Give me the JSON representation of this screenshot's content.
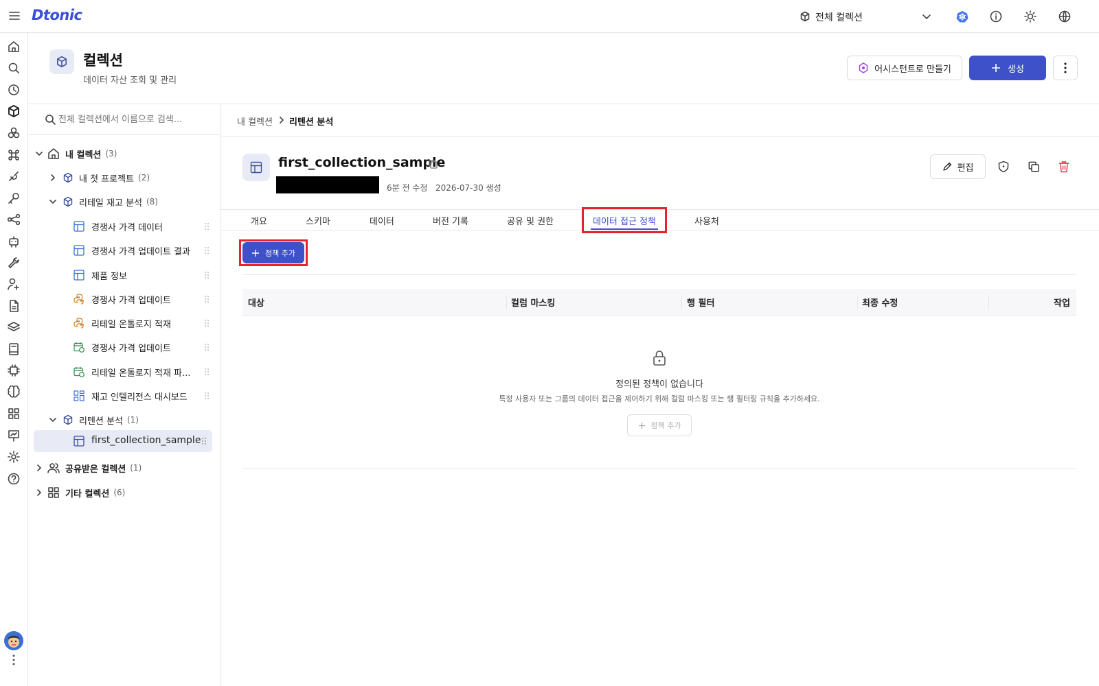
{
  "app": {
    "logo": "Dtonic"
  },
  "topbar": {
    "collection_select": "전체 컬렉션"
  },
  "page": {
    "title": "컬렉션",
    "subtitle": "데이터 자산 조회 및 관리",
    "assistant_button": "어시스턴트로 만들기",
    "create_button": "생성"
  },
  "search": {
    "placeholder": "전체 컬렉션에서 이름으로 검색..."
  },
  "tree": {
    "my_collections": {
      "label": "내 컬렉션",
      "count": "(3)"
    },
    "projects": [
      {
        "label": "내 첫 프로젝트",
        "count": "(2)"
      },
      {
        "label": "리테일 재고 분석",
        "count": "(8)"
      }
    ],
    "retail_items": [
      {
        "label": "경쟁사 가격 데이터",
        "icon": "table-icon"
      },
      {
        "label": "경쟁사 가격 업데이트 결과",
        "icon": "table-icon"
      },
      {
        "label": "제품 정보",
        "icon": "table-icon"
      },
      {
        "label": "경쟁사 가격 업데이트",
        "icon": "python-icon"
      },
      {
        "label": "리테일 온톨로지 적재",
        "icon": "python-icon"
      },
      {
        "label": "경쟁사 가격 업데이트",
        "icon": "schedule-icon"
      },
      {
        "label": "리테일 온톨로지 적재 파...",
        "icon": "schedule-icon"
      },
      {
        "label": "재고 인텔리전스 대시보드",
        "icon": "dashboard-icon"
      }
    ],
    "retention": {
      "label": "리텐션 분석",
      "count": "(1)"
    },
    "selected_item": "first_collection_sample",
    "shared": {
      "label": "공유받은 컬렉션",
      "count": "(1)"
    },
    "other": {
      "label": "기타 컬렉션",
      "count": "(6)"
    }
  },
  "breadcrumb": {
    "parent": "내 컬렉션",
    "current": "리텐션 분석"
  },
  "dataset": {
    "name": "first_collection_sample",
    "modified": "6분 전 수정",
    "created": "2026-07-30 생성",
    "edit_button": "편집"
  },
  "tabs": [
    "개요",
    "스키마",
    "데이터",
    "버전 기록",
    "공유 및 권한",
    "데이터 접근 정책",
    "사용처"
  ],
  "active_tab": "데이터 접근 정책",
  "policy": {
    "add_button": "정책 추가",
    "columns": [
      "대상",
      "컬럼 마스킹",
      "행 필터",
      "최종 수정",
      "작업"
    ],
    "empty_title": "정의된 정책이 없습니다",
    "empty_desc": "특정 사용자 또는 그룹의 데이터 접근을 제어하기 위해 컬럼 마스킹 또는 행 필터링 규칙을 추가하세요.",
    "empty_button": "정책 추가"
  },
  "colors": {
    "accent": "#3f51c8",
    "highlight": "#e4242a",
    "danger": "#d9363e"
  }
}
